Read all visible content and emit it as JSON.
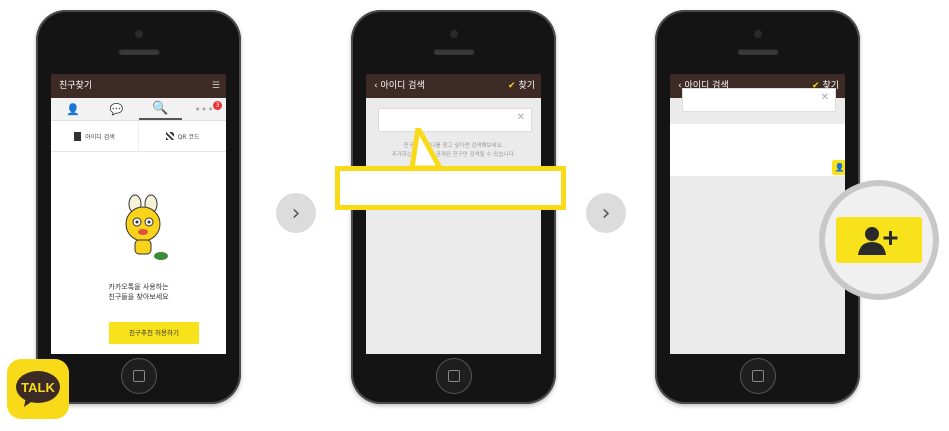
{
  "phone1": {
    "title": "친구찾기",
    "badge": "3",
    "menu": [
      "아이디 검색",
      "QR 코드"
    ],
    "friend_text": [
      "카카오톡을 사용하는",
      "친구들을 찾아보세요"
    ],
    "cta": "친구추천 허용하기"
  },
  "phone2": {
    "title": "아이디 검색",
    "action": "찾기",
    "hint": [
      "친구의 아이디를 찾고 싶다면 검색해보세요.",
      "추가하는 아이디에 공개된 친구만 검색될 수 있습니다."
    ]
  },
  "phone3": {
    "title": "아이디 검색",
    "action": "찾기"
  },
  "logo": {
    "text": "TALK"
  },
  "colors": {
    "accent": "#f8da18",
    "topbar": "#3e2b26"
  }
}
